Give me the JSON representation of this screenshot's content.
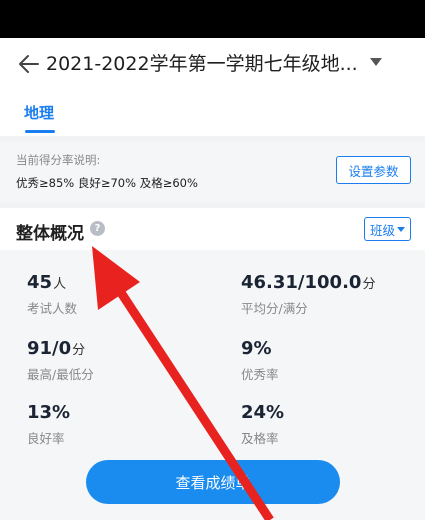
{
  "header": {
    "title": "2021-2022学年第一学期七年级地..."
  },
  "tabs": [
    {
      "label": "地理"
    }
  ],
  "score_info": {
    "label": "当前得分率说明:",
    "values": "优秀≥85% 良好≥70% 及格≥60%",
    "param_button": "设置参数"
  },
  "overview": {
    "title": "整体概况",
    "help_glyph": "?",
    "class_dropdown": "班级"
  },
  "stats": [
    {
      "value": "45",
      "unit": "人",
      "label": "考试人数"
    },
    {
      "value": "46.31/100.0",
      "unit": "分",
      "label": "平均分/满分"
    },
    {
      "value": "91/0",
      "unit": "分",
      "label": "最高/最低分"
    },
    {
      "value": "9%",
      "unit": "",
      "label": "优秀率"
    },
    {
      "value": "13%",
      "unit": "",
      "label": "良好率"
    },
    {
      "value": "24%",
      "unit": "",
      "label": "及格率"
    }
  ],
  "view_button": "查看成绩单",
  "colors": {
    "accent": "#1a7df0",
    "button": "#1a8cf0",
    "annotation_arrow": "#e8231f"
  }
}
